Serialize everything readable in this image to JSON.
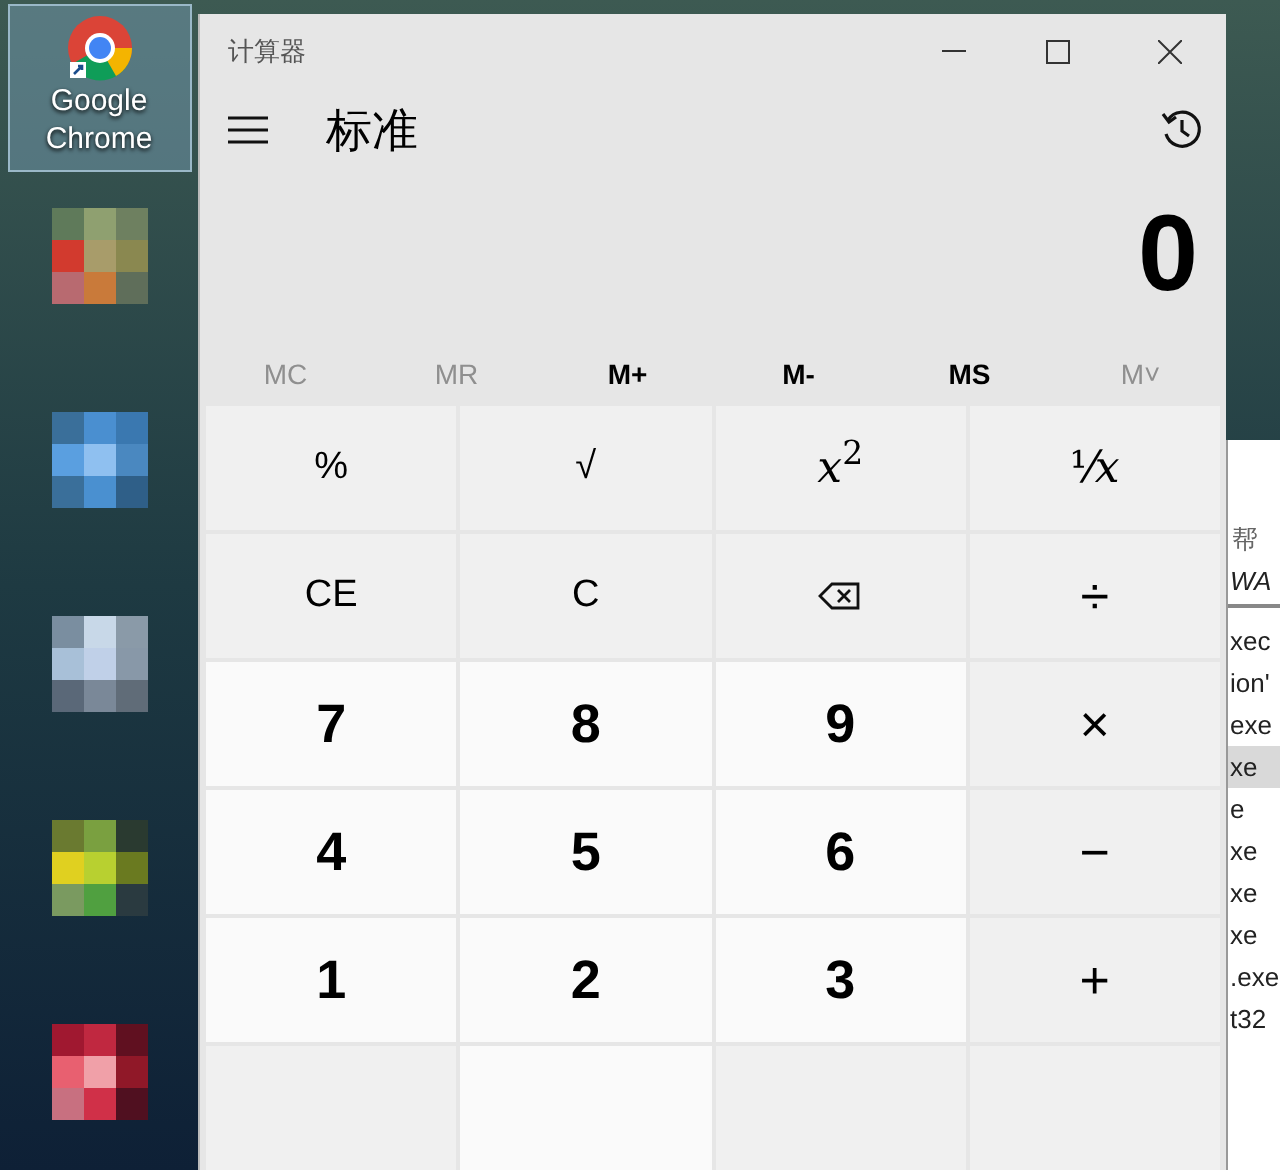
{
  "desktop": {
    "icons": [
      {
        "label": "Google Chrome",
        "selected": true
      }
    ]
  },
  "calculator": {
    "title": "计算器",
    "mode": "标准",
    "display": "0",
    "memory": [
      {
        "label": "MC",
        "disabled": true
      },
      {
        "label": "MR",
        "disabled": true
      },
      {
        "label": "M+",
        "disabled": false
      },
      {
        "label": "M-",
        "disabled": false
      },
      {
        "label": "MS",
        "disabled": false
      },
      {
        "label": "M˅",
        "disabled": true
      }
    ],
    "keys": [
      {
        "kind": "function",
        "label": "%"
      },
      {
        "kind": "function",
        "label": "√"
      },
      {
        "kind": "math",
        "label": "*x*$^{2}$"
      },
      {
        "kind": "math",
        "label": "¹⁄*x*"
      },
      {
        "kind": "function",
        "label": "CE"
      },
      {
        "kind": "function",
        "label": "C"
      },
      {
        "kind": "backspace"
      },
      {
        "kind": "operator",
        "label": "÷"
      },
      {
        "kind": "digit",
        "label": "7"
      },
      {
        "kind": "digit",
        "label": "8"
      },
      {
        "kind": "digit",
        "label": "9"
      },
      {
        "kind": "operator",
        "label": "×"
      },
      {
        "kind": "digit",
        "label": "4"
      },
      {
        "kind": "digit",
        "label": "5"
      },
      {
        "kind": "digit",
        "label": "6"
      },
      {
        "kind": "operator",
        "label": "−"
      },
      {
        "kind": "digit",
        "label": "1"
      },
      {
        "kind": "digit",
        "label": "2"
      },
      {
        "kind": "digit",
        "label": "3"
      },
      {
        "kind": "operator",
        "label": "+"
      },
      {
        "kind": "operator"
      },
      {
        "kind": "digit"
      },
      {
        "kind": "operator"
      },
      {
        "kind": "operator"
      }
    ]
  },
  "background_window": {
    "menu_item": "帮",
    "column_header": "WA",
    "rows": [
      {
        "text": "xec",
        "selected": false
      },
      {
        "text": "ion'",
        "selected": false
      },
      {
        "text": "exe",
        "selected": false
      },
      {
        "text": "xe",
        "selected": true
      },
      {
        "text": "e",
        "selected": false
      },
      {
        "text": "xe",
        "selected": false
      },
      {
        "text": "xe",
        "selected": false
      },
      {
        "text": "xe",
        "selected": false
      },
      {
        "text": ".exe",
        "selected": false
      },
      {
        "text": "t32",
        "selected": false
      }
    ]
  }
}
